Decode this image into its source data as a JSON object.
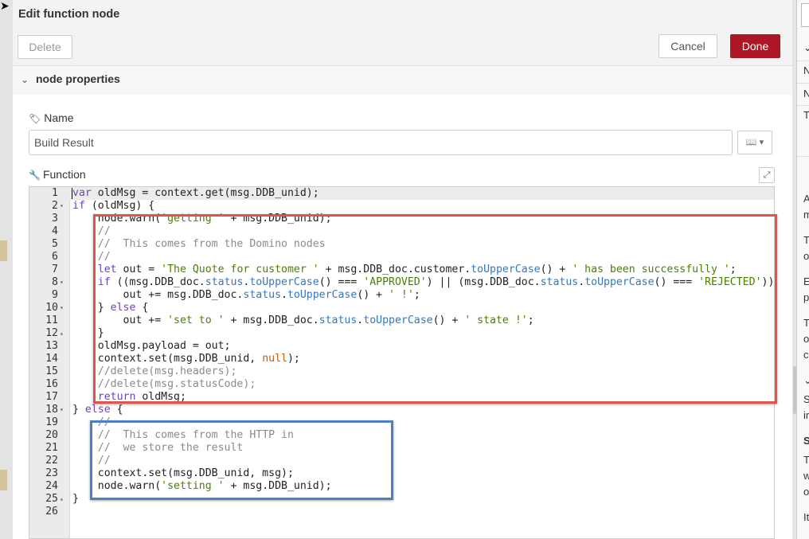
{
  "dialog": {
    "title": "Edit function node",
    "delete_label": "Delete",
    "cancel_label": "Cancel",
    "done_label": "Done",
    "section_title": "node properties"
  },
  "form": {
    "name_label": "Name",
    "name_value": "Build Result",
    "function_label": "Function"
  },
  "editor": {
    "lines": [
      {
        "n": "1",
        "fold": "",
        "code": "<span class=\"k\">var</span> oldMsg = context.get(msg.DDB_unid);"
      },
      {
        "n": "2",
        "fold": "▾",
        "code": "<span class=\"k\">if</span> (oldMsg) {"
      },
      {
        "n": "3",
        "fold": "",
        "code": "    node.warn(<span class=\"s\">'getting '</span> + msg.DDB_unid);"
      },
      {
        "n": "4",
        "fold": "",
        "code": "    <span class=\"c\">//</span>"
      },
      {
        "n": "5",
        "fold": "",
        "code": "    <span class=\"c\">//  This comes from the Domino nodes</span>"
      },
      {
        "n": "6",
        "fold": "",
        "code": "    <span class=\"c\">//</span>"
      },
      {
        "n": "7",
        "fold": "",
        "code": "    <span class=\"k\">let</span> out = <span class=\"s\">'The Quote for customer '</span> + msg.DDB_doc.customer.<span class=\"p\">toUpperCase</span>() + <span class=\"s\">' has been successfully '</span>;"
      },
      {
        "n": "8",
        "fold": "▾",
        "code": "    <span class=\"k\">if</span> ((msg.DDB_doc.<span class=\"p\">status</span>.<span class=\"p\">toUpperCase</span>() === <span class=\"s\">'APPROVED'</span>) || (msg.DDB_doc.<span class=\"p\">status</span>.<span class=\"p\">toUpperCase</span>() === <span class=\"s\">'REJECTED'</span>)) {"
      },
      {
        "n": "9",
        "fold": "",
        "code": "        out += msg.DDB_doc.<span class=\"p\">status</span>.<span class=\"p\">toUpperCase</span>() + <span class=\"s\">' !'</span>;"
      },
      {
        "n": "10",
        "fold": "▾",
        "code": "    } <span class=\"k\">else</span> {"
      },
      {
        "n": "11",
        "fold": "",
        "code": "        out += <span class=\"s\">'set to '</span> + msg.DDB_doc.<span class=\"p\">status</span>.<span class=\"p\">toUpperCase</span>() + <span class=\"s\">' state !'</span>;"
      },
      {
        "n": "12",
        "fold": "▴",
        "code": "    }"
      },
      {
        "n": "13",
        "fold": "",
        "code": "    oldMsg.payload = out;"
      },
      {
        "n": "14",
        "fold": "",
        "code": "    context.set(msg.DDB_unid, <span class=\"n\">null</span>);"
      },
      {
        "n": "15",
        "fold": "",
        "code": "    <span class=\"c\">//delete(msg.headers);</span>"
      },
      {
        "n": "16",
        "fold": "",
        "code": "    <span class=\"c\">//delete(msg.statusCode);</span>"
      },
      {
        "n": "17",
        "fold": "",
        "code": "    <span class=\"k\">return</span> oldMsg;"
      },
      {
        "n": "18",
        "fold": "▾",
        "code": "} <span class=\"k\">else</span> {"
      },
      {
        "n": "19",
        "fold": "",
        "code": "    <span class=\"c\">//</span>"
      },
      {
        "n": "20",
        "fold": "",
        "code": "    <span class=\"c\">//  This comes from the HTTP in</span>"
      },
      {
        "n": "21",
        "fold": "",
        "code": "    <span class=\"c\">//  we store the result</span>"
      },
      {
        "n": "22",
        "fold": "",
        "code": "    <span class=\"c\">//</span>"
      },
      {
        "n": "23",
        "fold": "",
        "code": "    context.set(msg.DDB_unid, msg);"
      },
      {
        "n": "24",
        "fold": "",
        "code": "    node.warn(<span class=\"s\">'setting '</span> + msg.DDB_unid);"
      },
      {
        "n": "25",
        "fold": "▴",
        "code": "}"
      },
      {
        "n": "26",
        "fold": "",
        "code": ""
      }
    ]
  },
  "side_panel": {
    "row_letters": [
      "N",
      "N",
      "T"
    ],
    "para_letters": [
      "A",
      "m",
      "T",
      "o",
      "E",
      "p",
      "T",
      "o",
      "c",
      "S",
      "ir",
      "S",
      "T",
      "w",
      "o",
      "It"
    ]
  },
  "colors": {
    "done_button": "#ad1625",
    "highlight_red": "#e0544e",
    "highlight_blue": "#4d7fc2"
  },
  "icons": {
    "name": "tag-icon",
    "function": "wrench-icon",
    "library": "book-icon",
    "expand": "expand-icon"
  }
}
